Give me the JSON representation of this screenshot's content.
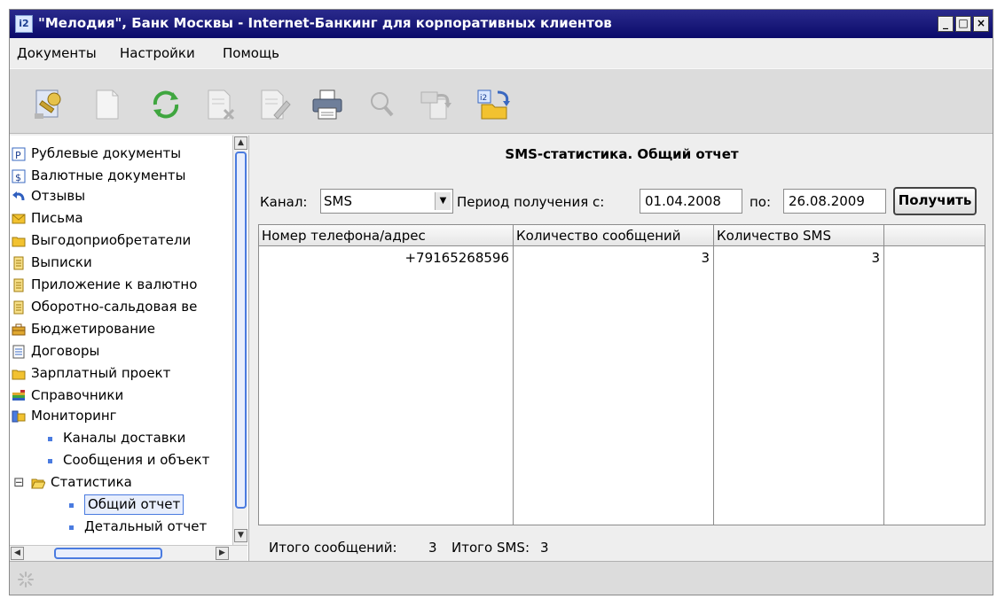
{
  "window": {
    "title": "\"Мелодия\", Банк Москвы - Internet-Банкинг для корпоративных клиентов",
    "app_icon_text": "i2",
    "min_label": "_",
    "max_label": "□",
    "close_label": "×"
  },
  "menu": {
    "items": [
      "Документы",
      "Настройки",
      "Помощь"
    ]
  },
  "toolbar": {
    "icons": [
      "keys-icon",
      "document-icon",
      "refresh-icon",
      "document-delete-icon",
      "document-edit-icon",
      "printer-icon",
      "search-icon",
      "export-icon",
      "open-folder-icon"
    ]
  },
  "tree": {
    "items": [
      {
        "label": "Рублевые документы",
        "icon": "ruble-doc-icon"
      },
      {
        "label": "Валютные документы",
        "icon": "currency-doc-icon"
      },
      {
        "label": "Отзывы",
        "icon": "recall-icon"
      },
      {
        "label": "Письма",
        "icon": "mail-icon"
      },
      {
        "label": "Выгодоприобретатели",
        "icon": "folder-icon"
      },
      {
        "label": "Выписки",
        "icon": "statement-icon"
      },
      {
        "label": "Приложение к валютно",
        "icon": "statement-icon"
      },
      {
        "label": "Оборотно-сальдовая ве",
        "icon": "statement-icon"
      },
      {
        "label": "Бюджетирование",
        "icon": "budget-icon"
      },
      {
        "label": "Договоры",
        "icon": "contract-icon"
      },
      {
        "label": "Зарплатный проект",
        "icon": "folder-icon"
      },
      {
        "label": "Справочники",
        "icon": "reference-books-icon"
      },
      {
        "label": "Мониторинг",
        "icon": "monitoring-icon"
      },
      {
        "label": "Каналы доставки",
        "icon": "bullet-icon"
      },
      {
        "label": "Сообщения и объект",
        "icon": "bullet-icon"
      },
      {
        "label": "Статистика",
        "icon": "open-folder-icon"
      },
      {
        "label": "Общий отчет",
        "icon": "bullet-icon",
        "selected": true
      },
      {
        "label": "Детальный отчет",
        "icon": "bullet-icon"
      }
    ],
    "collapse_glyph": "⊟"
  },
  "panel": {
    "title": "SMS-статистика. Общий отчет",
    "channel_label": "Канал:",
    "channel_value": "SMS",
    "period_label": "Период получения с:",
    "date_from": "01.04.2008",
    "to_label": "по:",
    "date_to": "26.08.2009",
    "get_button": "Получить"
  },
  "table": {
    "columns": [
      "Номер телефона/адрес",
      "Количество сообщений",
      "Количество SMS"
    ],
    "rows": [
      [
        "+79165268596",
        "3",
        "3"
      ]
    ]
  },
  "totals": {
    "messages_label": "Итого сообщений:",
    "messages_value": "3",
    "sms_label": "Итого SMS:",
    "sms_value": "3"
  },
  "colors": {
    "title_bar": "#0b0b6a",
    "selection_border": "#4a7be0",
    "folder": "#f2c230"
  }
}
